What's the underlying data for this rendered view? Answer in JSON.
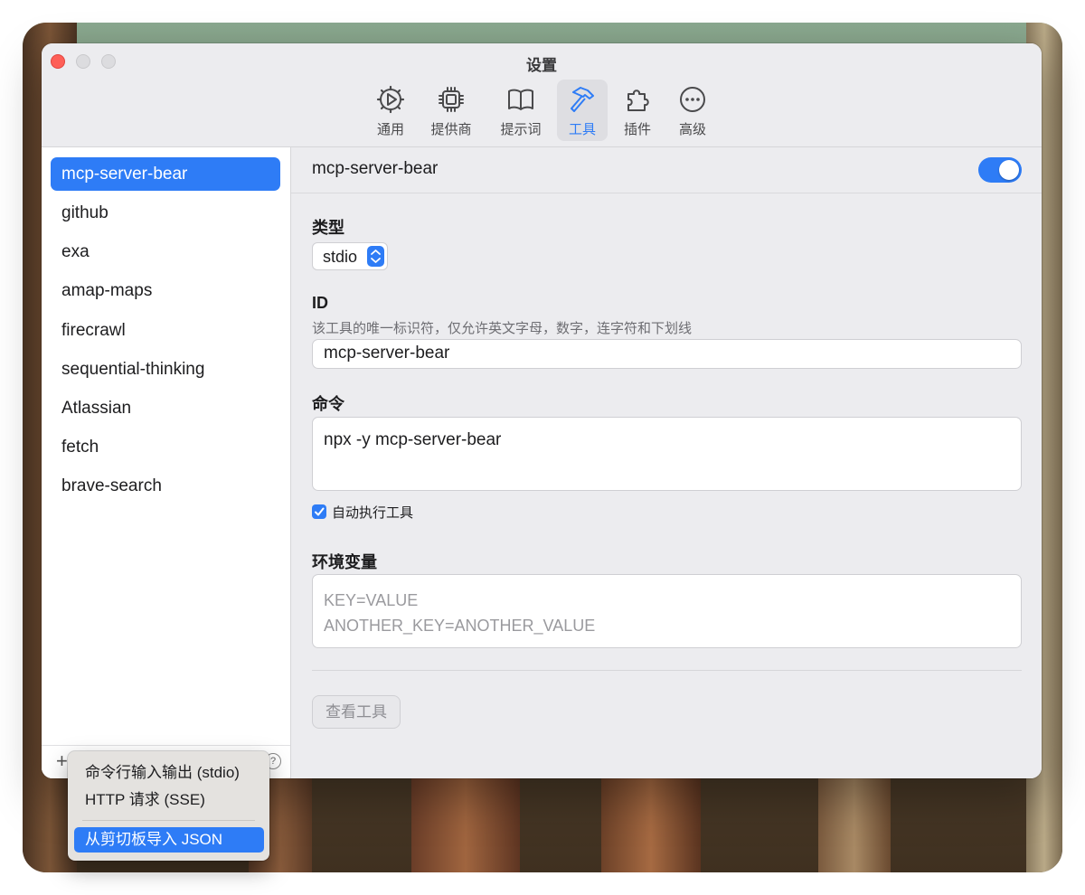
{
  "window": {
    "title": "设置"
  },
  "toolbar": {
    "tabs": [
      {
        "label": "通用",
        "icon": "gear-play-icon"
      },
      {
        "label": "提供商",
        "icon": "chip-icon"
      },
      {
        "label": "提示词",
        "icon": "book-icon"
      },
      {
        "label": "工具",
        "icon": "hammer-icon",
        "active": true
      },
      {
        "label": "插件",
        "icon": "puzzle-icon"
      },
      {
        "label": "高级",
        "icon": "ellipsis-circle-icon"
      }
    ]
  },
  "sidebar": {
    "items": [
      {
        "label": "mcp-server-bear",
        "selected": true
      },
      {
        "label": "github"
      },
      {
        "label": "exa"
      },
      {
        "label": "amap-maps"
      },
      {
        "label": "firecrawl"
      },
      {
        "label": "sequential-thinking"
      },
      {
        "label": "Atlassian"
      },
      {
        "label": "fetch"
      },
      {
        "label": "brave-search"
      }
    ],
    "footer": {
      "add": "+",
      "help": "?"
    }
  },
  "detail": {
    "title": "mcp-server-bear",
    "enabled": true,
    "type_label": "类型",
    "type_value": "stdio",
    "id_label": "ID",
    "id_hint": "该工具的唯一标识符，仅允许英文字母，数字，连字符和下划线",
    "id_value": "mcp-server-bear",
    "command_label": "命令",
    "command_value": "npx -y mcp-server-bear",
    "auto_exec_label": "自动执行工具",
    "auto_exec_checked": true,
    "env_label": "环境变量",
    "env_placeholder_line1": "KEY=VALUE",
    "env_placeholder_line2": "ANOTHER_KEY=ANOTHER_VALUE",
    "view_tools_button": "查看工具"
  },
  "popup_menu": {
    "items": [
      "命令行输入输出 (stdio)",
      "HTTP 请求 (SSE)",
      "从剪切板导入 JSON"
    ],
    "highlighted_index": 2
  },
  "colors": {
    "accent": "#2e7cf6",
    "close": "#fe5f57"
  }
}
